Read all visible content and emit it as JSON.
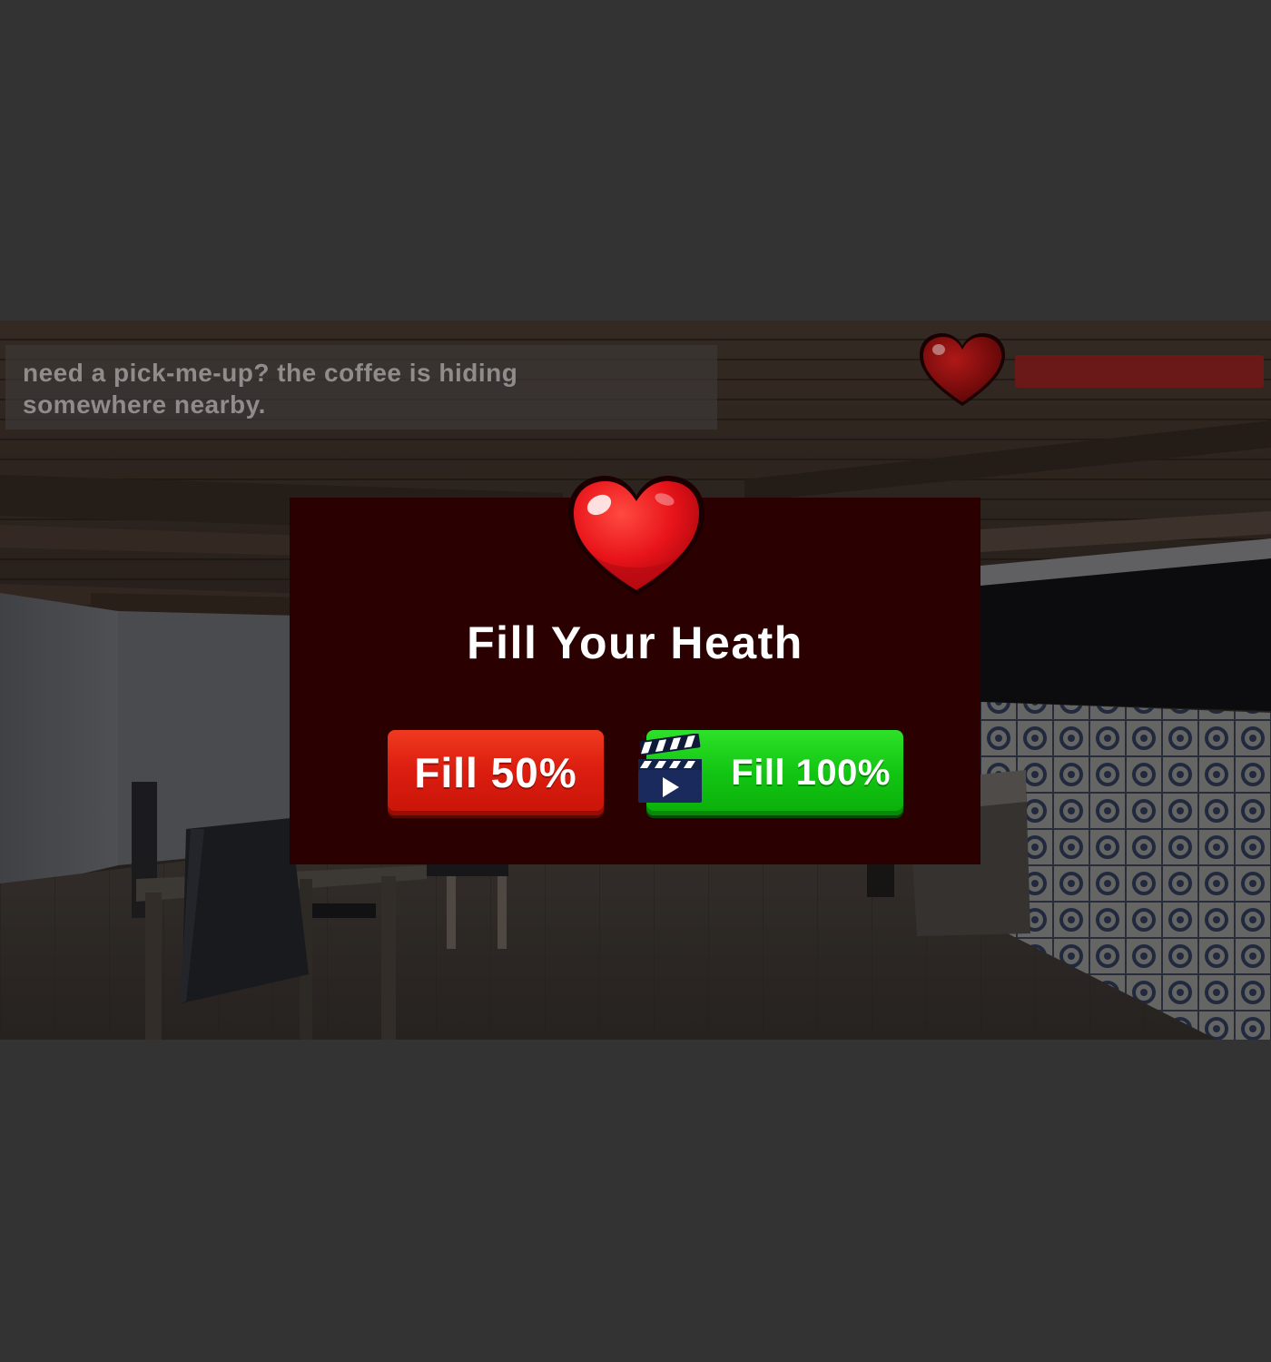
{
  "hint": {
    "text_line1": "need a pick-me-up? the coffee is hiding",
    "text_line2": "somewhere nearby."
  },
  "hud": {
    "health_icon": "heart-icon",
    "health_level": 1.0,
    "health_bar_color": "#781818"
  },
  "popup": {
    "icon": "heart-icon",
    "title": "Fill Your Heath",
    "background_color": "#2a0000",
    "buttons": {
      "fill_half_label": "Fill 50%",
      "fill_half_color": "#dc1e10",
      "fill_full_label": "Fill 100%",
      "fill_full_color": "#14c814",
      "fill_full_icon": "video-ad-icon"
    }
  }
}
